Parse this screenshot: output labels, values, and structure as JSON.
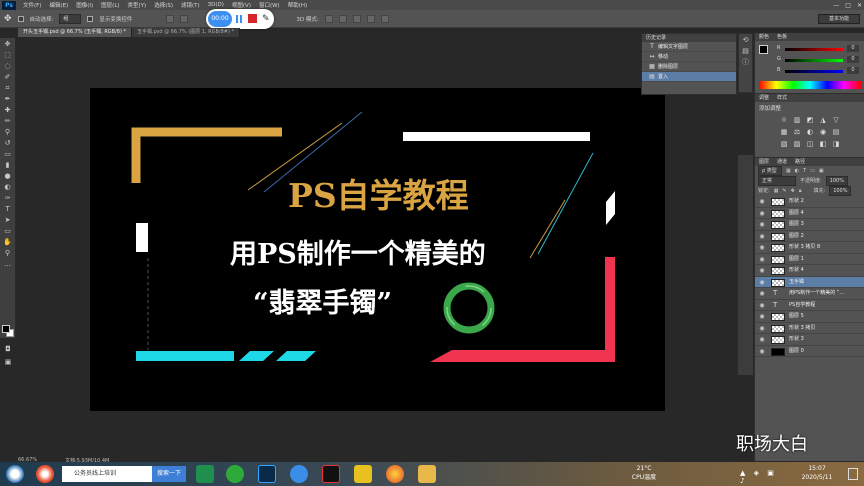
{
  "menubar": {
    "app_logo": "Ps",
    "items": [
      "文件(F)",
      "编辑(E)",
      "图像(I)",
      "图层(L)",
      "类型(Y)",
      "选择(S)",
      "滤镜(T)",
      "3D(D)",
      "视图(V)",
      "窗口(W)",
      "帮助(H)"
    ],
    "window_controls": [
      "—",
      "□",
      "✕"
    ]
  },
  "options": {
    "auto_select_label": "自动选择:",
    "auto_select_value": "组",
    "show_transform_label": "显示变换控件",
    "mode_3d_label": "3D 模式:",
    "workspace": "基本功能"
  },
  "recorder": {
    "time": "00:00",
    "pause_icon": "pause-icon",
    "stop_icon": "stop-icon",
    "pen_icon": "pen-icon"
  },
  "tabs": [
    {
      "label": "开头玉手镯.psd @ 66.7% (玉手镯, RGB/8) *",
      "active": true
    },
    {
      "label": "玉手镯.psd @ 66.7% (图层 1, RGB/8#) *",
      "active": false
    }
  ],
  "canvas": {
    "title": "PS自学教程",
    "line1": "用PS制作一个精美的",
    "line2": "“翡翠手镯”",
    "colors": {
      "gold": "#d9a441",
      "cyan": "#1ed8e8",
      "red": "#f0334f",
      "white": "#ffffff",
      "jade": "#3aa84a"
    }
  },
  "status": {
    "zoom": "66.67%",
    "doc": "文档:5.93M/10.4M"
  },
  "history": {
    "tabs": [
      "历史记录"
    ],
    "rows": [
      {
        "icon": "T",
        "label": "编辑文字图层"
      },
      {
        "icon": "↔",
        "label": "移动"
      },
      {
        "icon": "▦",
        "label": "删除图层"
      },
      {
        "icon": "▤",
        "label": "置入",
        "selected": true
      }
    ]
  },
  "color_panel": {
    "tabs": [
      "颜色",
      "色板"
    ],
    "channels": [
      {
        "name": "R",
        "value": "0"
      },
      {
        "name": "G",
        "value": "0"
      },
      {
        "name": "B",
        "value": "0"
      }
    ]
  },
  "adjust_panel": {
    "tabs": [
      "调整",
      "样式"
    ],
    "add_label": "添加调整",
    "icons": [
      "☼",
      "▥",
      "◩",
      "◮",
      "▽",
      "▦",
      "⚖",
      "◐",
      "◉",
      "▤",
      "▧",
      "▨",
      "◫",
      "◧",
      "◨"
    ]
  },
  "layers_panel": {
    "tabs": [
      "图层",
      "通道",
      "路径"
    ],
    "kind_label": "ρ 类型",
    "blend_mode": "正常",
    "opacity_label": "不透明度:",
    "opacity": "100%",
    "lock_label": "锁定:",
    "fill_label": "填充:",
    "fill": "100%",
    "layers": [
      {
        "name": "形状 2",
        "type": "shape"
      },
      {
        "name": "图层 4",
        "type": "shape"
      },
      {
        "name": "图层 3",
        "type": "shape"
      },
      {
        "name": "图层 2",
        "type": "shape"
      },
      {
        "name": "形状 3 拷贝 8",
        "type": "shape"
      },
      {
        "name": "图层 1",
        "type": "shape"
      },
      {
        "name": "形状 4",
        "type": "shape"
      },
      {
        "name": "玉手镯",
        "type": "smart",
        "selected": true
      },
      {
        "name": "用PS制作一个精美的 “...",
        "type": "text"
      },
      {
        "name": "PS自学教程",
        "type": "text"
      },
      {
        "name": "图层 5",
        "type": "shape"
      },
      {
        "name": "形状 3 拷贝",
        "type": "shape"
      },
      {
        "name": "形状 3",
        "type": "shape"
      },
      {
        "name": "图层 0",
        "type": "black"
      }
    ]
  },
  "taskbar": {
    "search_placeholder": "公务员线上培训",
    "search_button": "搜索一下",
    "weather_temp": "21°C",
    "weather_label": "CPU温度",
    "time": "15:07",
    "date": "2020/5/11"
  },
  "watermark": "职场大白"
}
